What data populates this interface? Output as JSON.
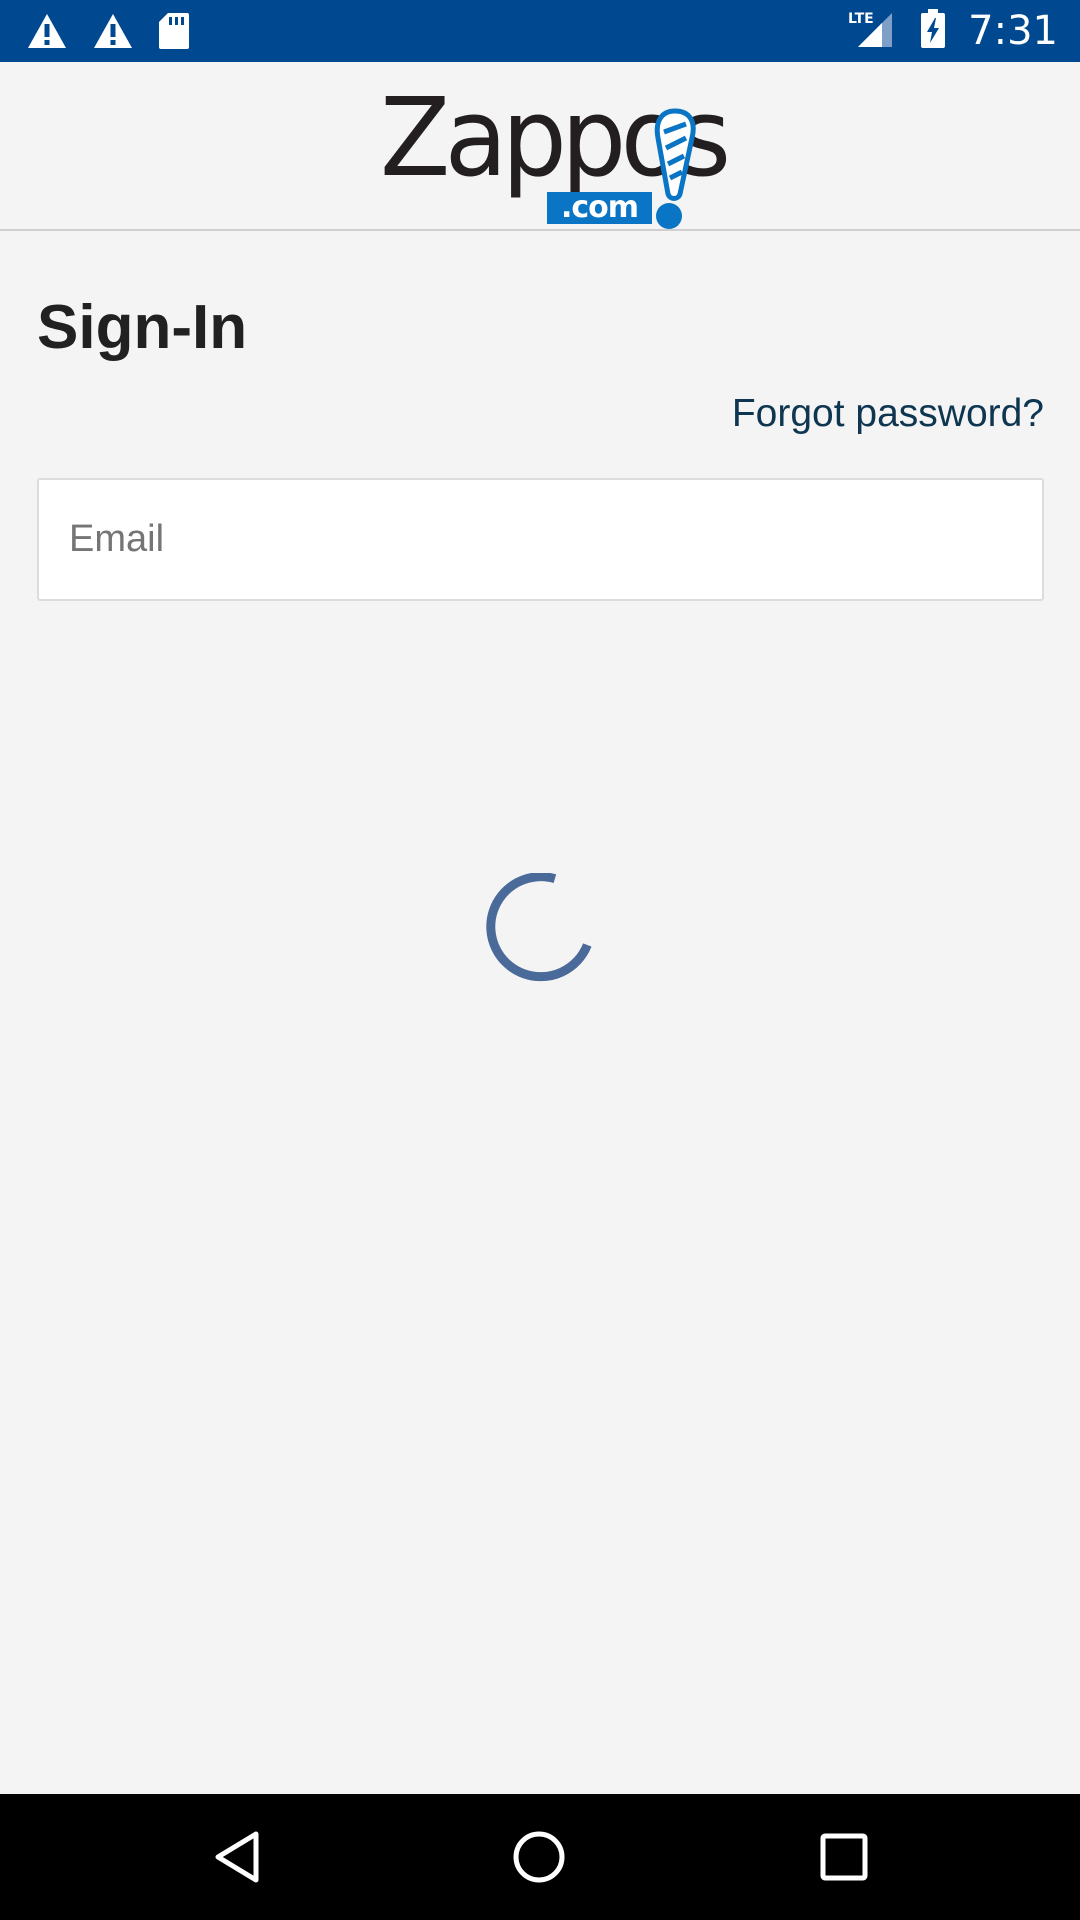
{
  "status_bar": {
    "time": "7:31",
    "network": "LTE",
    "icons": [
      "warning-icon",
      "warning-icon",
      "sd-card-icon",
      "lte-signal-icon",
      "battery-charging-icon"
    ]
  },
  "header": {
    "logo_text": "Zappos",
    "logo_domain": ".com"
  },
  "signin": {
    "title": "Sign-In",
    "forgot_password": "Forgot password?",
    "email_placeholder": "Email",
    "email_value": ""
  },
  "loading": {
    "icon": "loading-spinner-icon",
    "state": "loading"
  },
  "nav_bar": {
    "buttons": [
      "back-icon",
      "home-icon",
      "recents-icon"
    ]
  },
  "colors": {
    "status_bar": "#004990",
    "brand_blue": "#0a74c5",
    "link": "#0f3651",
    "spinner": "#4a6a99",
    "background": "#f4f4f4"
  }
}
